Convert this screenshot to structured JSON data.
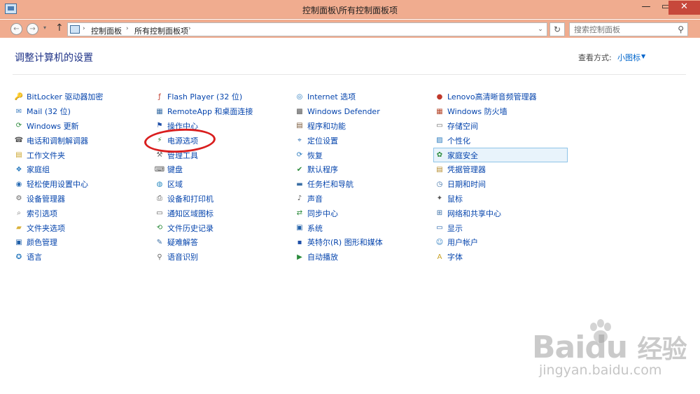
{
  "window": {
    "title": "控制面板\\所有控制面板项"
  },
  "window_controls": {
    "minimize": "—",
    "maximize": "▭",
    "close": "✕"
  },
  "nav": {
    "back": "←",
    "forward": "→",
    "dropdown": "▾",
    "up": "↑",
    "crumbs": [
      "控制面板",
      "所有控制面板项"
    ],
    "sep": "›",
    "addr_dropdown": "⌄",
    "refresh": "↻",
    "search_placeholder": "搜索控制面板",
    "search_glyph": "⚲"
  },
  "header": {
    "title": "调整计算机的设置",
    "view_by_label": "查看方式:",
    "view_by_value": "小图标",
    "view_arrow": "▼"
  },
  "columns": [
    [
      {
        "label": "BitLocker 驱动器加密",
        "icon": "bitlocker-icon"
      },
      {
        "label": "Mail (32 位)",
        "icon": "mail-icon"
      },
      {
        "label": "Windows 更新",
        "icon": "windows-update-icon"
      },
      {
        "label": "电话和调制解调器",
        "icon": "phone-modem-icon"
      },
      {
        "label": "工作文件夹",
        "icon": "work-folders-icon"
      },
      {
        "label": "家庭组",
        "icon": "homegroup-icon"
      },
      {
        "label": "轻松使用设置中心",
        "icon": "ease-of-access-icon"
      },
      {
        "label": "设备管理器",
        "icon": "device-manager-icon"
      },
      {
        "label": "索引选项",
        "icon": "indexing-icon"
      },
      {
        "label": "文件夹选项",
        "icon": "folder-options-icon"
      },
      {
        "label": "颜色管理",
        "icon": "color-management-icon"
      },
      {
        "label": "语言",
        "icon": "language-icon"
      }
    ],
    [
      {
        "label": "Flash Player (32 位)",
        "icon": "flash-icon"
      },
      {
        "label": "RemoteApp 和桌面连接",
        "icon": "remoteapp-icon"
      },
      {
        "label": "操作中心",
        "icon": "action-center-flag-icon"
      },
      {
        "label": "电源选项",
        "icon": "power-options-icon"
      },
      {
        "label": "管理工具",
        "icon": "admin-tools-icon"
      },
      {
        "label": "键盘",
        "icon": "keyboard-icon"
      },
      {
        "label": "区域",
        "icon": "region-icon"
      },
      {
        "label": "设备和打印机",
        "icon": "printer-icon"
      },
      {
        "label": "通知区域图标",
        "icon": "notification-icon"
      },
      {
        "label": "文件历史记录",
        "icon": "file-history-icon"
      },
      {
        "label": "疑难解答",
        "icon": "troubleshooting-icon"
      },
      {
        "label": "语音识别",
        "icon": "microphone-icon"
      }
    ],
    [
      {
        "label": "Internet 选项",
        "icon": "internet-options-icon"
      },
      {
        "label": "Windows Defender",
        "icon": "defender-icon"
      },
      {
        "label": "程序和功能",
        "icon": "programs-icon"
      },
      {
        "label": "定位设置",
        "icon": "location-icon"
      },
      {
        "label": "恢复",
        "icon": "recovery-icon"
      },
      {
        "label": "默认程序",
        "icon": "default-programs-icon"
      },
      {
        "label": "任务栏和导航",
        "icon": "taskbar-icon"
      },
      {
        "label": "声音",
        "icon": "sound-icon"
      },
      {
        "label": "同步中心",
        "icon": "sync-icon"
      },
      {
        "label": "系统",
        "icon": "system-icon"
      },
      {
        "label": "英特尔(R) 图形和媒体",
        "icon": "intel-graphics-icon"
      },
      {
        "label": "自动播放",
        "icon": "autoplay-icon"
      }
    ],
    [
      {
        "label": "Lenovo高清晰音频管理器",
        "icon": "lenovo-audio-icon"
      },
      {
        "label": "Windows 防火墙",
        "icon": "firewall-icon"
      },
      {
        "label": "存储空间",
        "icon": "storage-spaces-icon"
      },
      {
        "label": "个性化",
        "icon": "personalization-icon"
      },
      {
        "label": "家庭安全",
        "icon": "family-safety-icon"
      },
      {
        "label": "凭据管理器",
        "icon": "credential-manager-icon"
      },
      {
        "label": "日期和时间",
        "icon": "date-time-icon"
      },
      {
        "label": "鼠标",
        "icon": "mouse-icon"
      },
      {
        "label": "网络和共享中心",
        "icon": "network-icon"
      },
      {
        "label": "显示",
        "icon": "display-icon"
      },
      {
        "label": "用户帐户",
        "icon": "user-accounts-icon"
      },
      {
        "label": "字体",
        "icon": "fonts-icon"
      }
    ]
  ],
  "highlighted": "家庭安全",
  "colors": {
    "link": "#0645ad",
    "title": "#1e3287",
    "titlebar": "#f0ac8f",
    "annotation": "#d91e1e"
  },
  "watermark": {
    "main": "Bai",
    "du": "du",
    "brand": "经验",
    "url": "jingyan.baidu.com"
  }
}
